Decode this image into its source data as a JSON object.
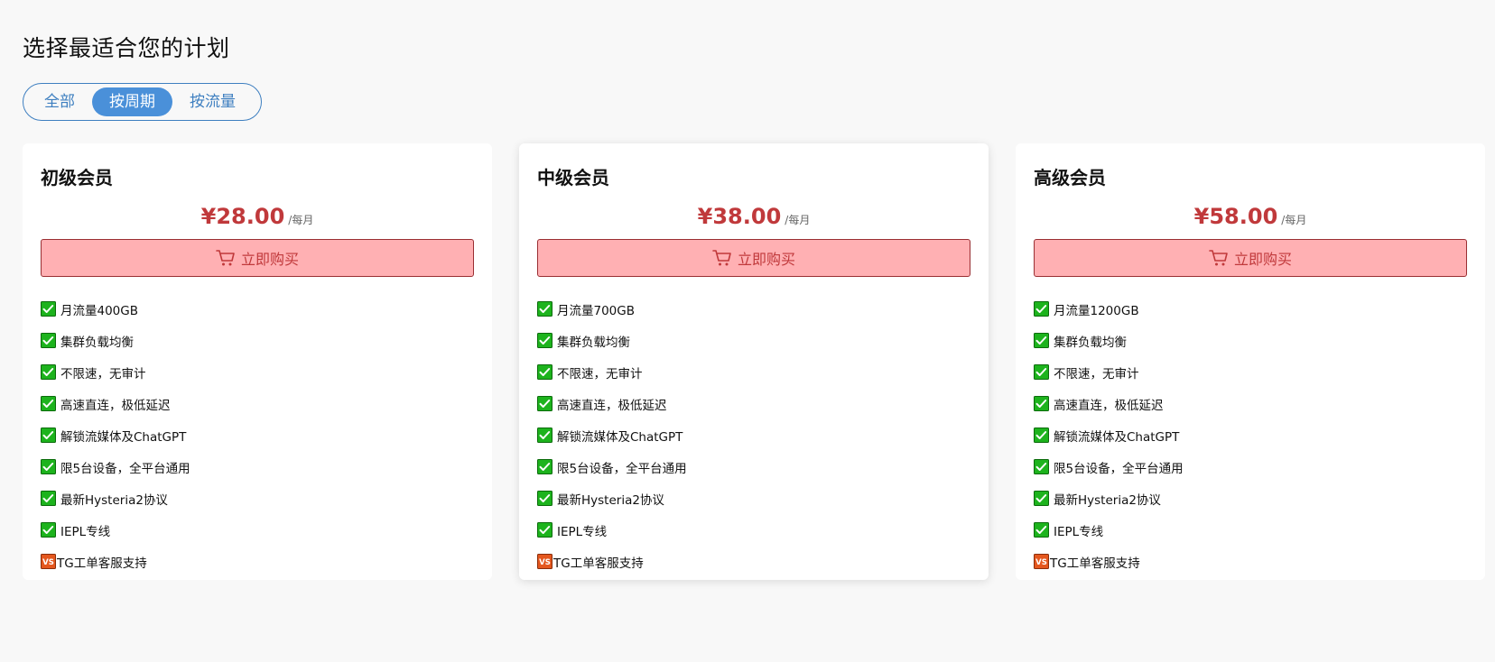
{
  "page": {
    "title": "选择最适合您的计划"
  },
  "filters": {
    "tabs": [
      {
        "label": "全部"
      },
      {
        "label": "按周期",
        "active": true
      },
      {
        "label": "按流量"
      }
    ]
  },
  "colors": {
    "accent": "#4a90d9",
    "price": "#c0393b",
    "buy_button_bg": "#ffb0b3",
    "check": "#1db31d",
    "vs_badge": "#e4571e"
  },
  "plans": [
    {
      "name": "初级会员",
      "price": "¥28.00",
      "period": "/每月",
      "buy_label": "立即购买",
      "buy_icon": "shopping-cart-icon",
      "features": [
        {
          "icon": "check-box-icon",
          "text": "月流量400GB"
        },
        {
          "icon": "check-box-icon",
          "text": "集群负载均衡"
        },
        {
          "icon": "check-box-icon",
          "text": "不限速，无审计"
        },
        {
          "icon": "check-box-icon",
          "text": "高速直连，极低延迟"
        },
        {
          "icon": "check-box-icon",
          "text": "解锁流媒体及ChatGPT"
        },
        {
          "icon": "check-box-icon",
          "text": "限5台设备，全平台通用"
        },
        {
          "icon": "check-box-icon",
          "text": "最新Hysteria2协议"
        },
        {
          "icon": "check-box-icon",
          "text": "IEPL专线"
        },
        {
          "icon": "vs-badge-icon",
          "text": "TG工单客服支持"
        }
      ]
    },
    {
      "name": "中级会员",
      "price": "¥38.00",
      "period": "/每月",
      "buy_label": "立即购买",
      "buy_icon": "shopping-cart-icon",
      "features": [
        {
          "icon": "check-box-icon",
          "text": "月流量700GB"
        },
        {
          "icon": "check-box-icon",
          "text": "集群负载均衡"
        },
        {
          "icon": "check-box-icon",
          "text": "不限速，无审计"
        },
        {
          "icon": "check-box-icon",
          "text": "高速直连，极低延迟"
        },
        {
          "icon": "check-box-icon",
          "text": "解锁流媒体及ChatGPT"
        },
        {
          "icon": "check-box-icon",
          "text": "限5台设备，全平台通用"
        },
        {
          "icon": "check-box-icon",
          "text": "最新Hysteria2协议"
        },
        {
          "icon": "check-box-icon",
          "text": "IEPL专线"
        },
        {
          "icon": "vs-badge-icon",
          "text": "TG工单客服支持"
        }
      ]
    },
    {
      "name": "高级会员",
      "price": "¥58.00",
      "period": "/每月",
      "buy_label": "立即购买",
      "buy_icon": "shopping-cart-icon",
      "features": [
        {
          "icon": "check-box-icon",
          "text": "月流量1200GB"
        },
        {
          "icon": "check-box-icon",
          "text": "集群负载均衡"
        },
        {
          "icon": "check-box-icon",
          "text": "不限速，无审计"
        },
        {
          "icon": "check-box-icon",
          "text": "高速直连，极低延迟"
        },
        {
          "icon": "check-box-icon",
          "text": "解锁流媒体及ChatGPT"
        },
        {
          "icon": "check-box-icon",
          "text": "限5台设备，全平台通用"
        },
        {
          "icon": "check-box-icon",
          "text": "最新Hysteria2协议"
        },
        {
          "icon": "check-box-icon",
          "text": "IEPL专线"
        },
        {
          "icon": "vs-badge-icon",
          "text": "TG工单客服支持"
        }
      ]
    }
  ]
}
